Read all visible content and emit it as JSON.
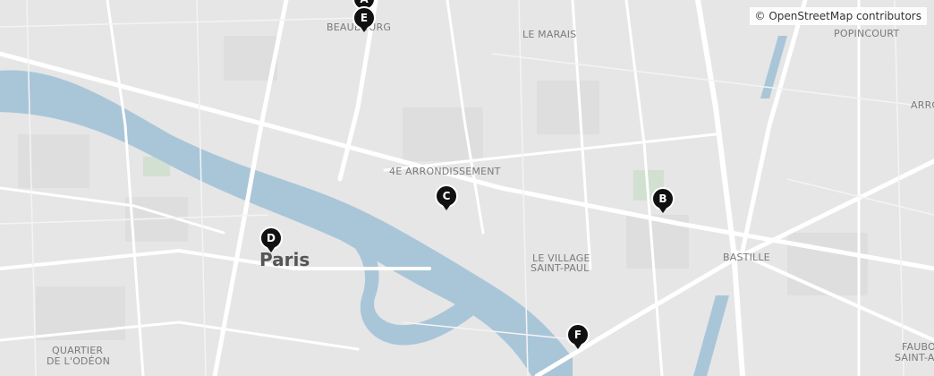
{
  "map": {
    "colors": {
      "land": "#e6e6e6",
      "block": "#dcdcdc",
      "road": "#ffffff",
      "water": "#a9c6d9",
      "park": "#d2e3d2",
      "marker": "#111111"
    }
  },
  "places": {
    "beaubourg": "BEAUBOURG",
    "le_marais": "LE MARAIS",
    "popincourt": "POPINCOURT",
    "arrondissement_4e": "4E ARRONDISSEMENT",
    "le_village": "LE VILLAGE",
    "saint_paul": "SAINT-PAUL",
    "bastille": "BASTILLE",
    "quartier": "QUARTIER",
    "de_l_odeon": "DE L'ODÉON",
    "arro_partial": "ARRO",
    "faubo_partial": "FAUBO",
    "saint_an_partial": "SAINT-AN"
  },
  "city": {
    "name": "Paris"
  },
  "markers": [
    {
      "id": "A",
      "label": "A"
    },
    {
      "id": "E",
      "label": "E"
    },
    {
      "id": "C",
      "label": "C"
    },
    {
      "id": "B",
      "label": "B"
    },
    {
      "id": "D",
      "label": "D"
    },
    {
      "id": "F",
      "label": "F"
    }
  ],
  "attribution": "© OpenStreetMap contributors"
}
